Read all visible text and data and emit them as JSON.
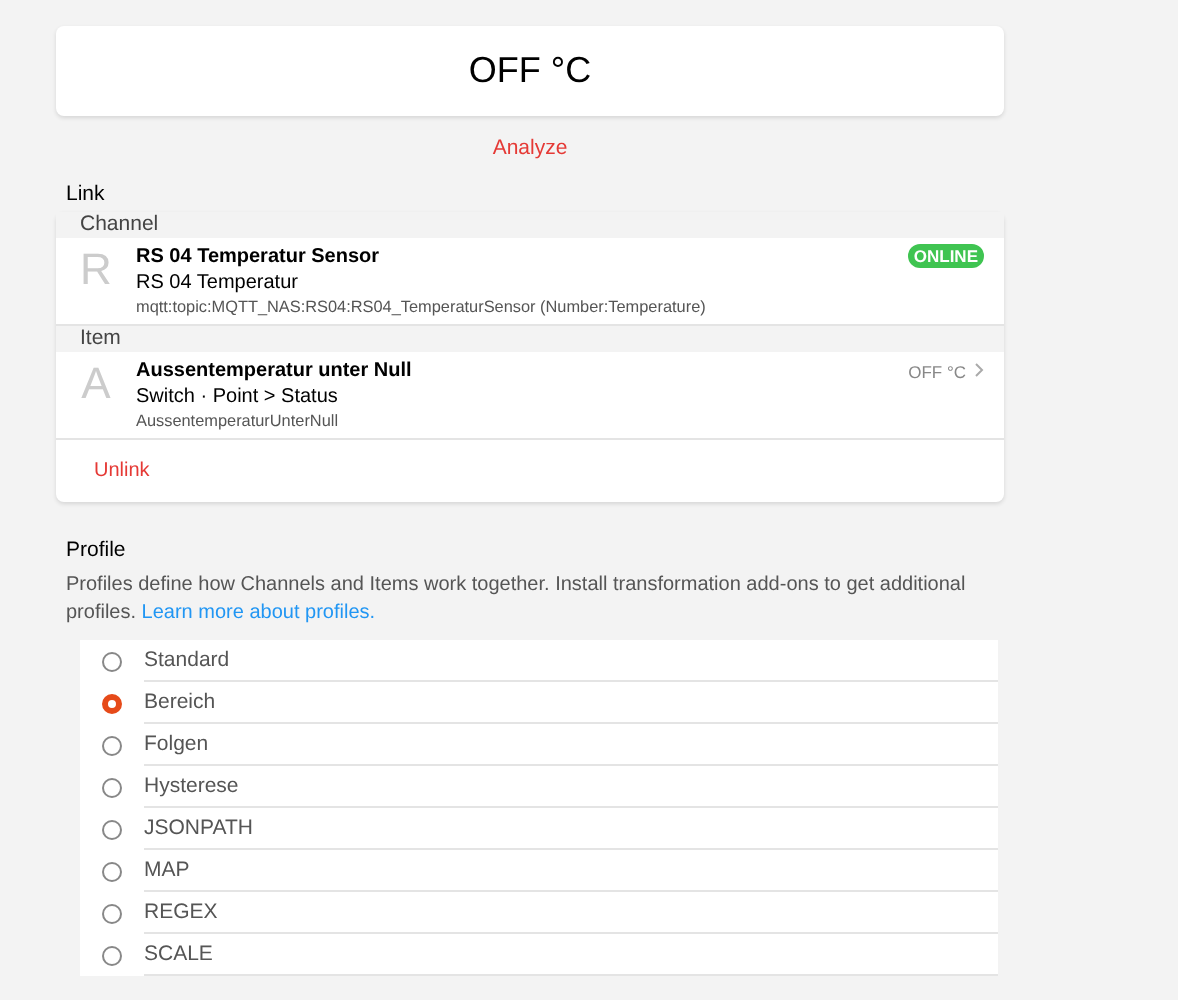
{
  "state_card": {
    "value": "OFF °C"
  },
  "analyze_link": "Analyze",
  "link_section": {
    "title": "Link",
    "channel": {
      "header": "Channel",
      "letter": "R",
      "title": "RS 04 Temperatur Sensor",
      "subtitle": "RS 04 Temperatur",
      "detail": "mqtt:topic:MQTT_NAS:RS04:RS04_TemperaturSensor (Number:Temperature)",
      "badge": "ONLINE"
    },
    "item": {
      "header": "Item",
      "letter": "A",
      "title": "Aussentemperatur unter Null",
      "subtitle": "Switch · Point > Status",
      "detail": "AussentemperaturUnterNull",
      "state": "OFF °C"
    },
    "unlink": "Unlink"
  },
  "profile_section": {
    "title": "Profile",
    "description": "Profiles define how Channels and Items work together. Install transformation add-ons to get additional profiles.",
    "learn_more": "Learn more about profiles.",
    "options": [
      {
        "label": "Standard",
        "selected": false
      },
      {
        "label": "Bereich",
        "selected": true
      },
      {
        "label": "Folgen",
        "selected": false
      },
      {
        "label": "Hysterese",
        "selected": false
      },
      {
        "label": "JSONPATH",
        "selected": false
      },
      {
        "label": "MAP",
        "selected": false
      },
      {
        "label": "REGEX",
        "selected": false
      },
      {
        "label": "SCALE",
        "selected": false
      }
    ]
  }
}
